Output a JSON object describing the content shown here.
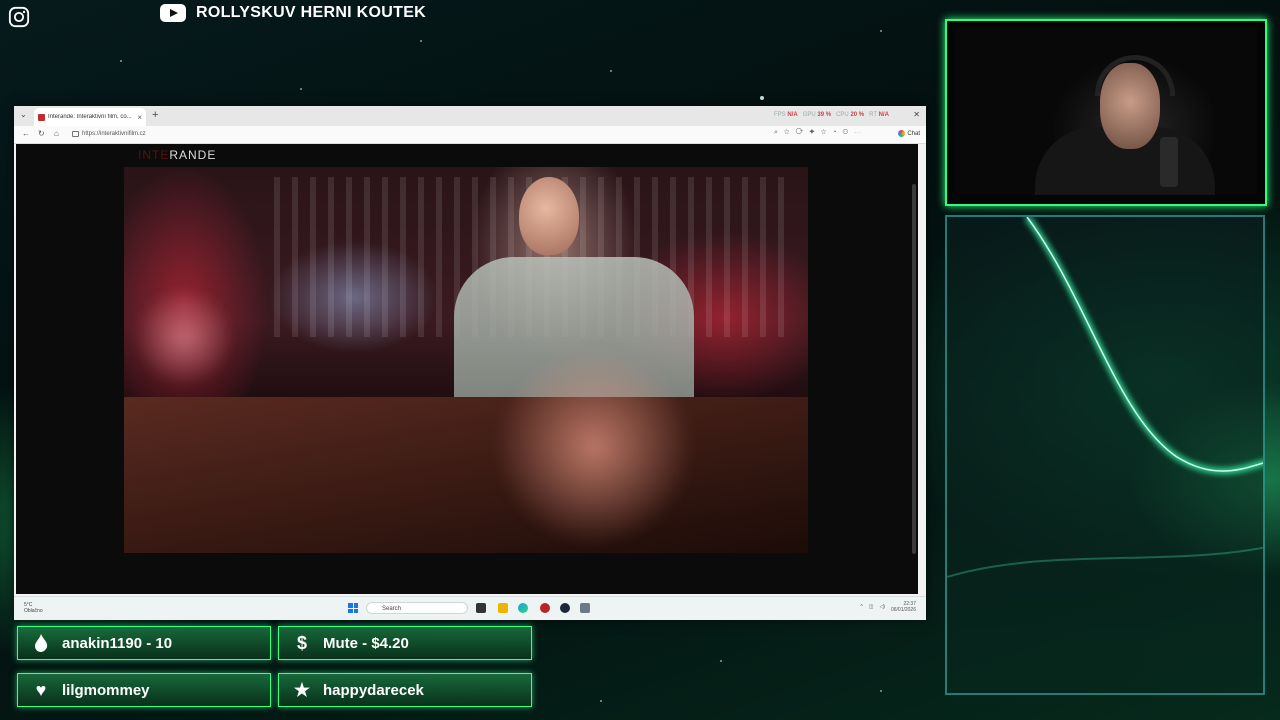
{
  "overlay": {
    "instagram_icon": "instagram-icon",
    "youtube_icon": "youtube-icon",
    "youtube_channel": "ROLLYSKUV HERNI KOUTEK"
  },
  "browser": {
    "tab_title": "Interande: Interaktivní film, co...",
    "url": "https://interaktivnifilm.cz",
    "stats": {
      "fps_label": "FPS",
      "fps": "N/A",
      "gpu_label": "GPU",
      "gpu": "39 %",
      "cpu_label": "CPU",
      "cpu": "20 %",
      "ram_label": "RT",
      "ram": "N/A"
    },
    "chat_label": "Chat",
    "site_logo_a": "INTE",
    "site_logo_b": "RANDE"
  },
  "taskbar": {
    "weather_temp": "5°C",
    "weather_desc": "Oblačno",
    "search_placeholder": "Search",
    "time": "22:37",
    "date": "06/01/2026"
  },
  "alerts": [
    {
      "icon": "flame-icon",
      "text": "anakin1190 - 10"
    },
    {
      "icon": "dollar-icon",
      "text": "Mute - $4.20"
    },
    {
      "icon": "heart-icon",
      "text": "lilgmommey"
    },
    {
      "icon": "star-icon",
      "text": "happydarecek"
    }
  ],
  "colors": {
    "accent_green": "#2cff7a",
    "panel_border": "#3cc8c8",
    "browser_tab_favicon": "#c12c2c"
  }
}
